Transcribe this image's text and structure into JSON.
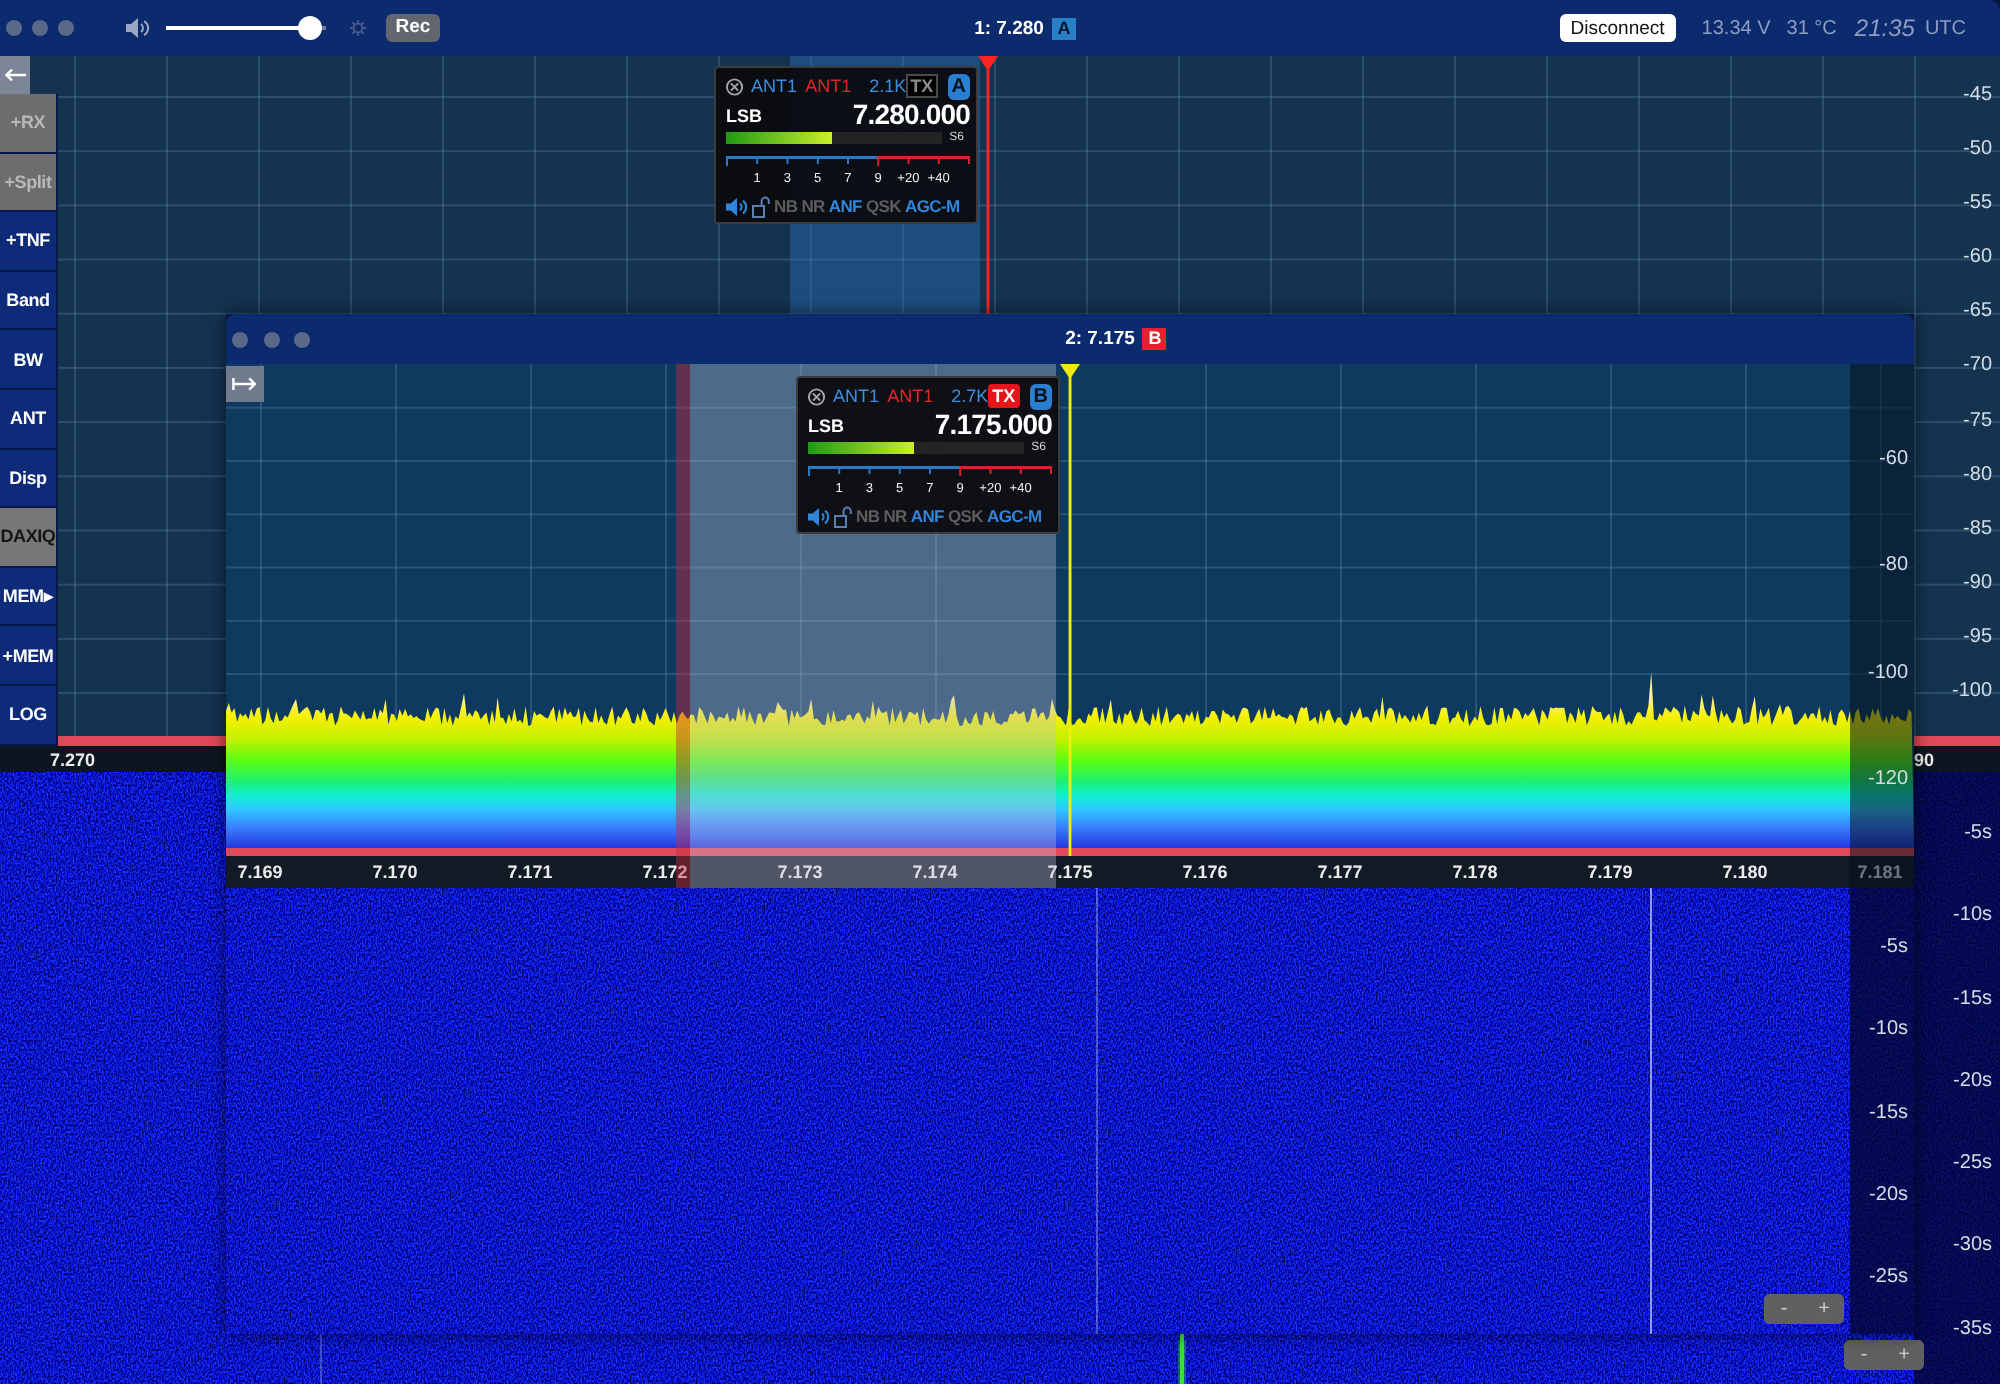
{
  "main_window": {
    "title": "1: 7.280",
    "title_badge": "A",
    "toolbar": {
      "volume": {
        "level": 0.9
      },
      "record_button": "Rec",
      "disconnect_button": "Disconnect",
      "voltage": "13.34 V",
      "temperature": "31 °C",
      "time": "21:35",
      "timezone": "UTC"
    },
    "side_buttons": [
      {
        "label": "+RX",
        "disabled": true,
        "active": false
      },
      {
        "label": "+Split",
        "disabled": true,
        "active": false
      },
      {
        "label": "+TNF",
        "disabled": false,
        "active": false
      },
      {
        "label": "Band",
        "disabled": false,
        "active": false
      },
      {
        "label": "BW",
        "disabled": false,
        "active": false
      },
      {
        "label": "ANT",
        "disabled": false,
        "active": false
      },
      {
        "label": "Disp",
        "disabled": false,
        "active": false
      },
      {
        "label": "DAXIQ",
        "disabled": false,
        "active": true
      },
      {
        "label": "MEM▸",
        "disabled": false,
        "active": false
      },
      {
        "label": "+MEM",
        "disabled": false,
        "active": false
      },
      {
        "label": "LOG",
        "disabled": false,
        "active": false
      }
    ],
    "panadapter": {
      "db_scale": [
        "-45",
        "-50",
        "-55",
        "-60",
        "-65",
        "-70",
        "-75",
        "-80",
        "-85",
        "-90",
        "-95",
        "-100"
      ],
      "frequency_axis": [
        "7.270",
        "90"
      ],
      "slice": {
        "rx_antenna": "ANT1",
        "tx_antenna": "ANT1",
        "filter_width": "2.1K",
        "tx_button": "TX",
        "tx": false,
        "letter": "A",
        "mode": "LSB",
        "frequency": "7.280.000",
        "s_meter": {
          "level": 0.49,
          "reading": "S6",
          "scale": [
            "1",
            "3",
            "5",
            "7",
            "9",
            "+20",
            "+40"
          ]
        },
        "dsp_buttons": [
          {
            "label": "NB",
            "on": false
          },
          {
            "label": "NR",
            "on": false
          },
          {
            "label": "ANF",
            "on": true
          },
          {
            "label": "QSK",
            "on": false
          },
          {
            "label": "AGC-M",
            "on": true
          }
        ]
      }
    },
    "waterfall": {
      "time_scale": [
        "-5s",
        "-10s",
        "-15s",
        "-20s",
        "-25s",
        "-30s",
        "-35s"
      ],
      "zoom_buttons": [
        "-",
        "+"
      ]
    }
  },
  "second_window": {
    "title": "2: 7.175",
    "title_badge": "B",
    "panadapter": {
      "db_scale": [
        "-60",
        "-80",
        "-100",
        "-120"
      ],
      "frequency_axis": [
        "7.169",
        "7.170",
        "7.171",
        "7.172",
        "7.173",
        "7.174",
        "7.175",
        "7.176",
        "7.177",
        "7.178",
        "7.179",
        "7.180",
        "7.181"
      ],
      "slice": {
        "rx_antenna": "ANT1",
        "tx_antenna": "ANT1",
        "filter_width": "2.7K",
        "tx_button": "TX",
        "tx": true,
        "letter": "B",
        "mode": "LSB",
        "frequency": "7.175.000",
        "s_meter": {
          "level": 0.49,
          "reading": "S6",
          "scale": [
            "1",
            "3",
            "5",
            "7",
            "9",
            "+20",
            "+40"
          ]
        },
        "dsp_buttons": [
          {
            "label": "NB",
            "on": false
          },
          {
            "label": "NR",
            "on": false
          },
          {
            "label": "ANF",
            "on": true
          },
          {
            "label": "QSK",
            "on": false
          },
          {
            "label": "AGC-M",
            "on": true
          }
        ]
      }
    },
    "waterfall": {
      "time_scale": [
        "-5s",
        "-10s",
        "-15s",
        "-20s",
        "-25s"
      ],
      "zoom_buttons": [
        "-",
        "+"
      ]
    }
  }
}
